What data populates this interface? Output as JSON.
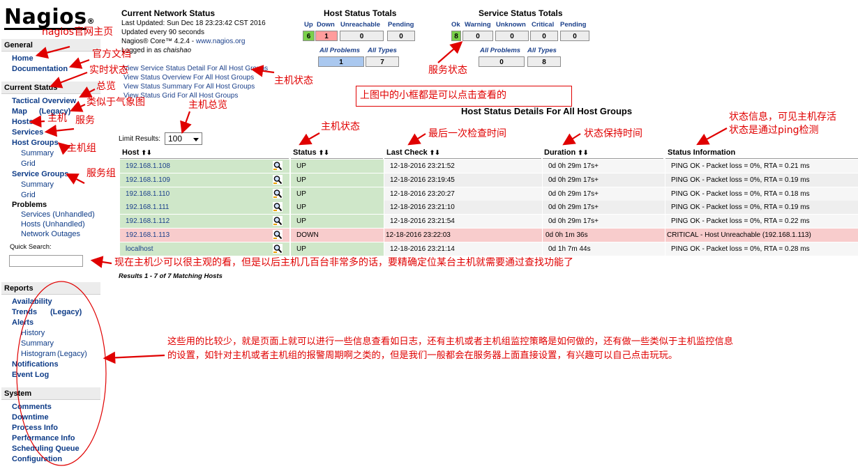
{
  "logo": {
    "text": "Nagios",
    "mark": "®"
  },
  "sidebar": {
    "general": {
      "title": "General",
      "items": [
        "Home",
        "Documentation"
      ]
    },
    "current_status": {
      "title": "Current Status",
      "tactical": "Tactical Overview",
      "map": "Map",
      "map_legacy": "(Legacy)",
      "hosts": "Hosts",
      "services": "Services",
      "host_groups": "Host Groups",
      "hg_summary": "Summary",
      "hg_grid": "Grid",
      "service_groups": "Service Groups",
      "sg_summary": "Summary",
      "sg_grid": "Grid",
      "problems": "Problems",
      "svc_unhandled": "Services (Unhandled)",
      "hosts_unhandled": "Hosts (Unhandled)",
      "network_outages": "Network Outages",
      "quick_search_label": "Quick Search:"
    },
    "reports": {
      "title": "Reports",
      "availability": "Availability",
      "trends": "Trends",
      "trends_legacy": "(Legacy)",
      "alerts": "Alerts",
      "history": "History",
      "summary": "Summary",
      "histogram": "Histogram",
      "histogram_legacy": "(Legacy)",
      "notifications": "Notifications",
      "event_log": "Event Log"
    },
    "system": {
      "title": "System",
      "items": [
        "Comments",
        "Downtime",
        "Process Info",
        "Performance Info",
        "Scheduling Queue",
        "Configuration"
      ]
    }
  },
  "status_header": {
    "title": "Current Network Status",
    "last_updated": "Last Updated: Sun Dec 18 23:23:42 CST 2016",
    "update_interval": "Updated every 90 seconds",
    "core_prefix": "Nagios® Core™ 4.2.4 - ",
    "core_link": "www.nagios.org",
    "logged_in_prefix": "Logged in as ",
    "user": "chaishao",
    "links": [
      "View Service Status Detail For All Host Groups",
      "View Status Overview For All Host Groups",
      "View Status Summary For All Host Groups",
      "View Status Grid For All Host Groups"
    ]
  },
  "host_totals": {
    "title": "Host Status Totals",
    "labels": [
      "Up",
      "Down",
      "Unreachable",
      "Pending"
    ],
    "values": [
      "6",
      "1",
      "0",
      "0"
    ],
    "sub_labels": [
      "All Problems",
      "All Types"
    ],
    "sub_values": [
      "1",
      "7"
    ]
  },
  "service_totals": {
    "title": "Service Status Totals",
    "labels": [
      "Ok",
      "Warning",
      "Unknown",
      "Critical",
      "Pending"
    ],
    "values": [
      "8",
      "0",
      "0",
      "0",
      "0"
    ],
    "sub_labels": [
      "All Problems",
      "All Types"
    ],
    "sub_values": [
      "0",
      "8"
    ]
  },
  "table": {
    "title": "Host Status Details For All Host Groups",
    "limit_label": "Limit Results:",
    "limit_value": "100",
    "columns": [
      "Host",
      "Status",
      "Last Check",
      "Duration",
      "Status Information"
    ],
    "sort_glyph": "⬆⬇",
    "rows": [
      {
        "host": "192.168.1.108",
        "status": "UP",
        "last_check": "12-18-2016 23:21:52",
        "duration": "0d 0h 29m 17s+",
        "info": "PING OK - Packet loss = 0%, RTA = 0.21 ms",
        "state": "up"
      },
      {
        "host": "192.168.1.109",
        "status": "UP",
        "last_check": "12-18-2016 23:19:45",
        "duration": "0d 0h 29m 17s+",
        "info": "PING OK - Packet loss = 0%, RTA = 0.19 ms",
        "state": "up"
      },
      {
        "host": "192.168.1.110",
        "status": "UP",
        "last_check": "12-18-2016 23:20:27",
        "duration": "0d 0h 29m 17s+",
        "info": "PING OK - Packet loss = 0%, RTA = 0.18 ms",
        "state": "up"
      },
      {
        "host": "192.168.1.111",
        "status": "UP",
        "last_check": "12-18-2016 23:21:10",
        "duration": "0d 0h 29m 17s+",
        "info": "PING OK - Packet loss = 0%, RTA = 0.19 ms",
        "state": "up"
      },
      {
        "host": "192.168.1.112",
        "status": "UP",
        "last_check": "12-18-2016 23:21:54",
        "duration": "0d 0h 29m 17s+",
        "info": "PING OK - Packet loss = 0%, RTA = 0.22 ms",
        "state": "up"
      },
      {
        "host": "192.168.1.113",
        "status": "DOWN",
        "last_check": "12-18-2016 23:22:03",
        "duration": "0d 0h 1m 36s",
        "info": "CRITICAL - Host Unreachable (192.168.1.113)",
        "state": "down"
      },
      {
        "host": "localhost",
        "status": "UP",
        "last_check": "12-18-2016 23:21:14",
        "duration": "0d 1h 7m 44s",
        "info": "PING OK - Packet loss = 0%, RTA = 0.28 ms",
        "state": "up"
      }
    ],
    "results_text": "Results 1 - 7 of 7 Matching Hosts"
  },
  "annotations": {
    "home": "nagios官网主页",
    "docs": "官方文档",
    "realtime": "实时状态",
    "overview": "总览",
    "weather": "类似于气象图",
    "host": "主机",
    "service": "服务",
    "hostgroup": "主机组",
    "servicegroup": "服务组",
    "host_total": "主机总览",
    "host_state_top": "主机状态",
    "service_state": "服务状态",
    "clickable_note": "上图中的小框都是可以点击查看的",
    "host_state": "主机状态",
    "last_check": "最后一次检查时间",
    "duration": "状态保持时间",
    "status_info_1": "状态信息，可见主机存活",
    "status_info_2": "状态是通过ping检测",
    "search_note": "现在主机少可以很主观的看，但是以后主机几百台非常多的话，要精确定位某台主机就需要通过查找功能了",
    "reports_note_1": "这些用的比较少，就是页面上就可以进行一些信息查看如日志，还有主机或者主机组监控策略是如何做的，还有做一些类似于主机监控信息",
    "reports_note_2": "的设置，如针对主机或者主机组的报警周期啊之类的，但是我们一般都会在服务器上面直接设置，有兴趣可以自己点击玩玩。"
  },
  "colors": {
    "up_row": "#cfe7c9",
    "down_row": "#f8cccc",
    "alt_row": "#eeeeee",
    "link": "#1a3f8a",
    "annotation": "#e00000"
  }
}
